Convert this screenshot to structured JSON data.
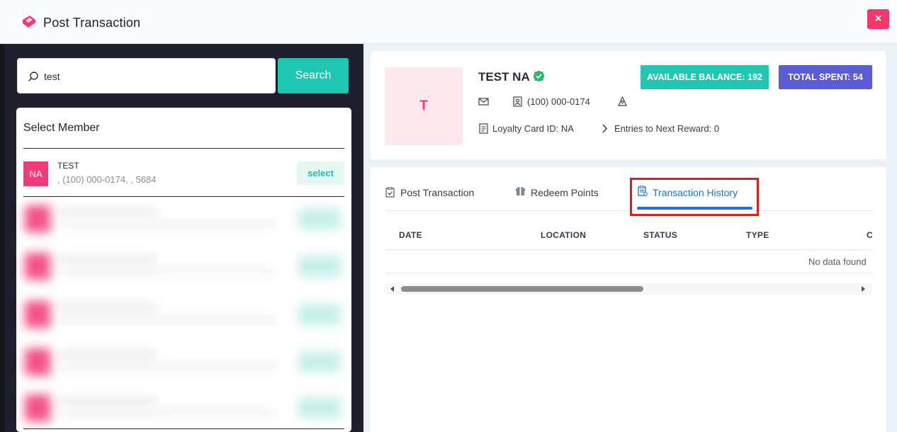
{
  "header": {
    "title": "Post Transaction",
    "close_label": "×",
    "logo_icon": "ticket-icon"
  },
  "search": {
    "value": "test",
    "button_label": "Search"
  },
  "member_list": {
    "title": "Select Member",
    "members": [
      {
        "initials": "NA",
        "name": "TEST",
        "details": ", (100) 000-0174, , 5684",
        "select_label": "select"
      }
    ]
  },
  "profile": {
    "initial": "T",
    "name": "TEST NA",
    "available_balance": "AVAILABLE BALANCE: 192",
    "total_spent": "TOTAL SPENT: 54",
    "phone": "(100) 000-0174",
    "loyalty_card": "Loyalty Card ID: NA",
    "entries_to_next_reward": "Entries to Next Reward: 0"
  },
  "tabs": [
    {
      "label": "Post Transaction",
      "icon": "clipboard-check-icon"
    },
    {
      "label": "Redeem Points",
      "icon": "gift-icon"
    },
    {
      "label": "Transaction History",
      "icon": "clipboard-list-icon",
      "active": true
    }
  ],
  "table": {
    "columns": [
      "DATE",
      "LOCATION",
      "STATUS",
      "TYPE",
      "C"
    ],
    "empty_message": "No data found"
  },
  "colors": {
    "accent_teal": "#1fc6b1",
    "accent_purple": "#5b5bd6",
    "brand_pink": "#f23a76",
    "active_tab_blue": "#1e6fe0",
    "highlight_red": "#e41a1a"
  }
}
